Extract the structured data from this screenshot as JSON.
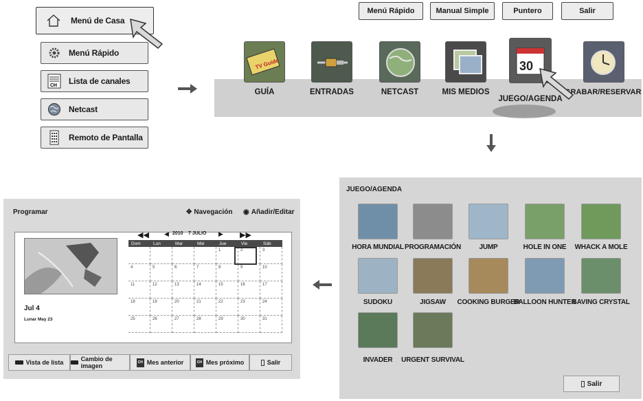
{
  "home_menu": {
    "active_label": "Menú de Casa",
    "items": [
      {
        "label": "Menú Rápido",
        "icon": "gear-icon"
      },
      {
        "label": "Lista de canales",
        "icon": "channel-list-icon",
        "icon_text": "CH"
      },
      {
        "label": "Netcast",
        "icon": "globe-icon"
      },
      {
        "label": "Remoto de Pantalla",
        "icon": "remote-icon"
      }
    ]
  },
  "top_buttons": [
    "Menú Rápido",
    "Manual Simple",
    "Puntero",
    "Salir"
  ],
  "cards": [
    {
      "label": "GUÍA",
      "icon": "tv-guide-icon",
      "icon_text": "TV Guide"
    },
    {
      "label": "ENTRADAS",
      "icon": "cable-icon"
    },
    {
      "label": "NETCAST",
      "icon": "globe-icon"
    },
    {
      "label": "MIS MEDIOS",
      "icon": "media-icon"
    },
    {
      "label": "JUEGO/AGENDA",
      "icon": "calendar-icon",
      "icon_text": "30"
    },
    {
      "label": "GRABAR/RESERVAR",
      "icon": "clock-icon"
    }
  ],
  "calendar": {
    "title": "Programar",
    "nav_hint": "Navegación",
    "add_hint": "Añadir/Editar",
    "year": "2010",
    "month_label": "7 JULIO",
    "date_label": "Jul 4",
    "lunar_label": "Lunar May 23",
    "weekdays": [
      "Dom",
      "Lun",
      "Mar",
      "Mié",
      "Jue",
      "Vie",
      "Sáb"
    ],
    "days": [
      "",
      "",
      "",
      "",
      "1",
      "2",
      "3",
      "4",
      "5",
      "6",
      "7",
      "8",
      "9",
      "10",
      "11",
      "12",
      "13",
      "14",
      "15",
      "16",
      "17",
      "18",
      "19",
      "20",
      "21",
      "22",
      "23",
      "24",
      "25",
      "26",
      "27",
      "28",
      "29",
      "30",
      "31"
    ],
    "bottom_buttons": [
      {
        "label": "Vista de lista",
        "key": ""
      },
      {
        "label": "Cambio de imagen",
        "key": ""
      },
      {
        "label": "Mes anterior",
        "key": "CH"
      },
      {
        "label": "Mes próximo",
        "key": "CH"
      },
      {
        "label": "Salir",
        "key": ""
      }
    ]
  },
  "games": {
    "title": "JUEGO/AGENDA",
    "items": [
      {
        "label": "HORA MUNDIAL",
        "color": "#6f8fa8"
      },
      {
        "label": "PROGRAMACIÓN",
        "color": "#8c8c8c"
      },
      {
        "label": "JUMP",
        "color": "#9fb6c9"
      },
      {
        "label": "HOLE IN ONE",
        "color": "#7aa06a"
      },
      {
        "label": "WHACK A MOLE",
        "color": "#6f9a5c"
      },
      {
        "label": "SUDOKU",
        "color": "#9db3c4"
      },
      {
        "label": "JIGSAW",
        "color": "#8a7a5a"
      },
      {
        "label": "COOKING BURGER",
        "color": "#a68a5c"
      },
      {
        "label": "BALLOON HUNTER",
        "color": "#7f9ab3"
      },
      {
        "label": "SAVING CRYSTAL",
        "color": "#6a8f6a"
      },
      {
        "label": "INVADER",
        "color": "#5a7a5a"
      },
      {
        "label": "URGENT SURVIVAL",
        "color": "#6a7a5a"
      }
    ],
    "exit_label": "Salir"
  }
}
